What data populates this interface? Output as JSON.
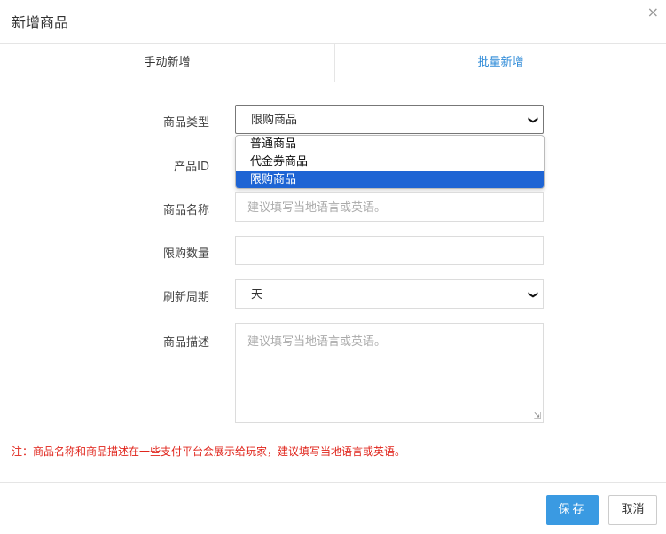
{
  "dialog": {
    "title": "新增商品",
    "close_icon": "×"
  },
  "tabs": [
    {
      "label": "手动新增",
      "active": true
    },
    {
      "label": "批量新增",
      "active": false
    }
  ],
  "form": {
    "product_type": {
      "label": "商品类型",
      "value": "限购商品",
      "options": [
        "普通商品",
        "代金券商品",
        "限购商品"
      ],
      "selected_index": 2
    },
    "product_id": {
      "label": "产品ID"
    },
    "product_name": {
      "label": "商品名称",
      "placeholder": "建议填写当地语言或英语。"
    },
    "limit_quantity": {
      "label": "限购数量",
      "value": ""
    },
    "refresh_cycle": {
      "label": "刷新周期",
      "value": "天"
    },
    "description": {
      "label": "商品描述",
      "placeholder": "建议填写当地语言或英语。"
    }
  },
  "note": "注：商品名称和商品描述在一些支付平台会展示给玩家，建议填写当地语言或英语。",
  "buttons": {
    "save": "保存",
    "cancel": "取消"
  },
  "colors": {
    "primary": "#3a9ae2",
    "tab_link": "#2f8bd8",
    "warning": "#e0241b",
    "selected_option": "#1e64d4"
  }
}
